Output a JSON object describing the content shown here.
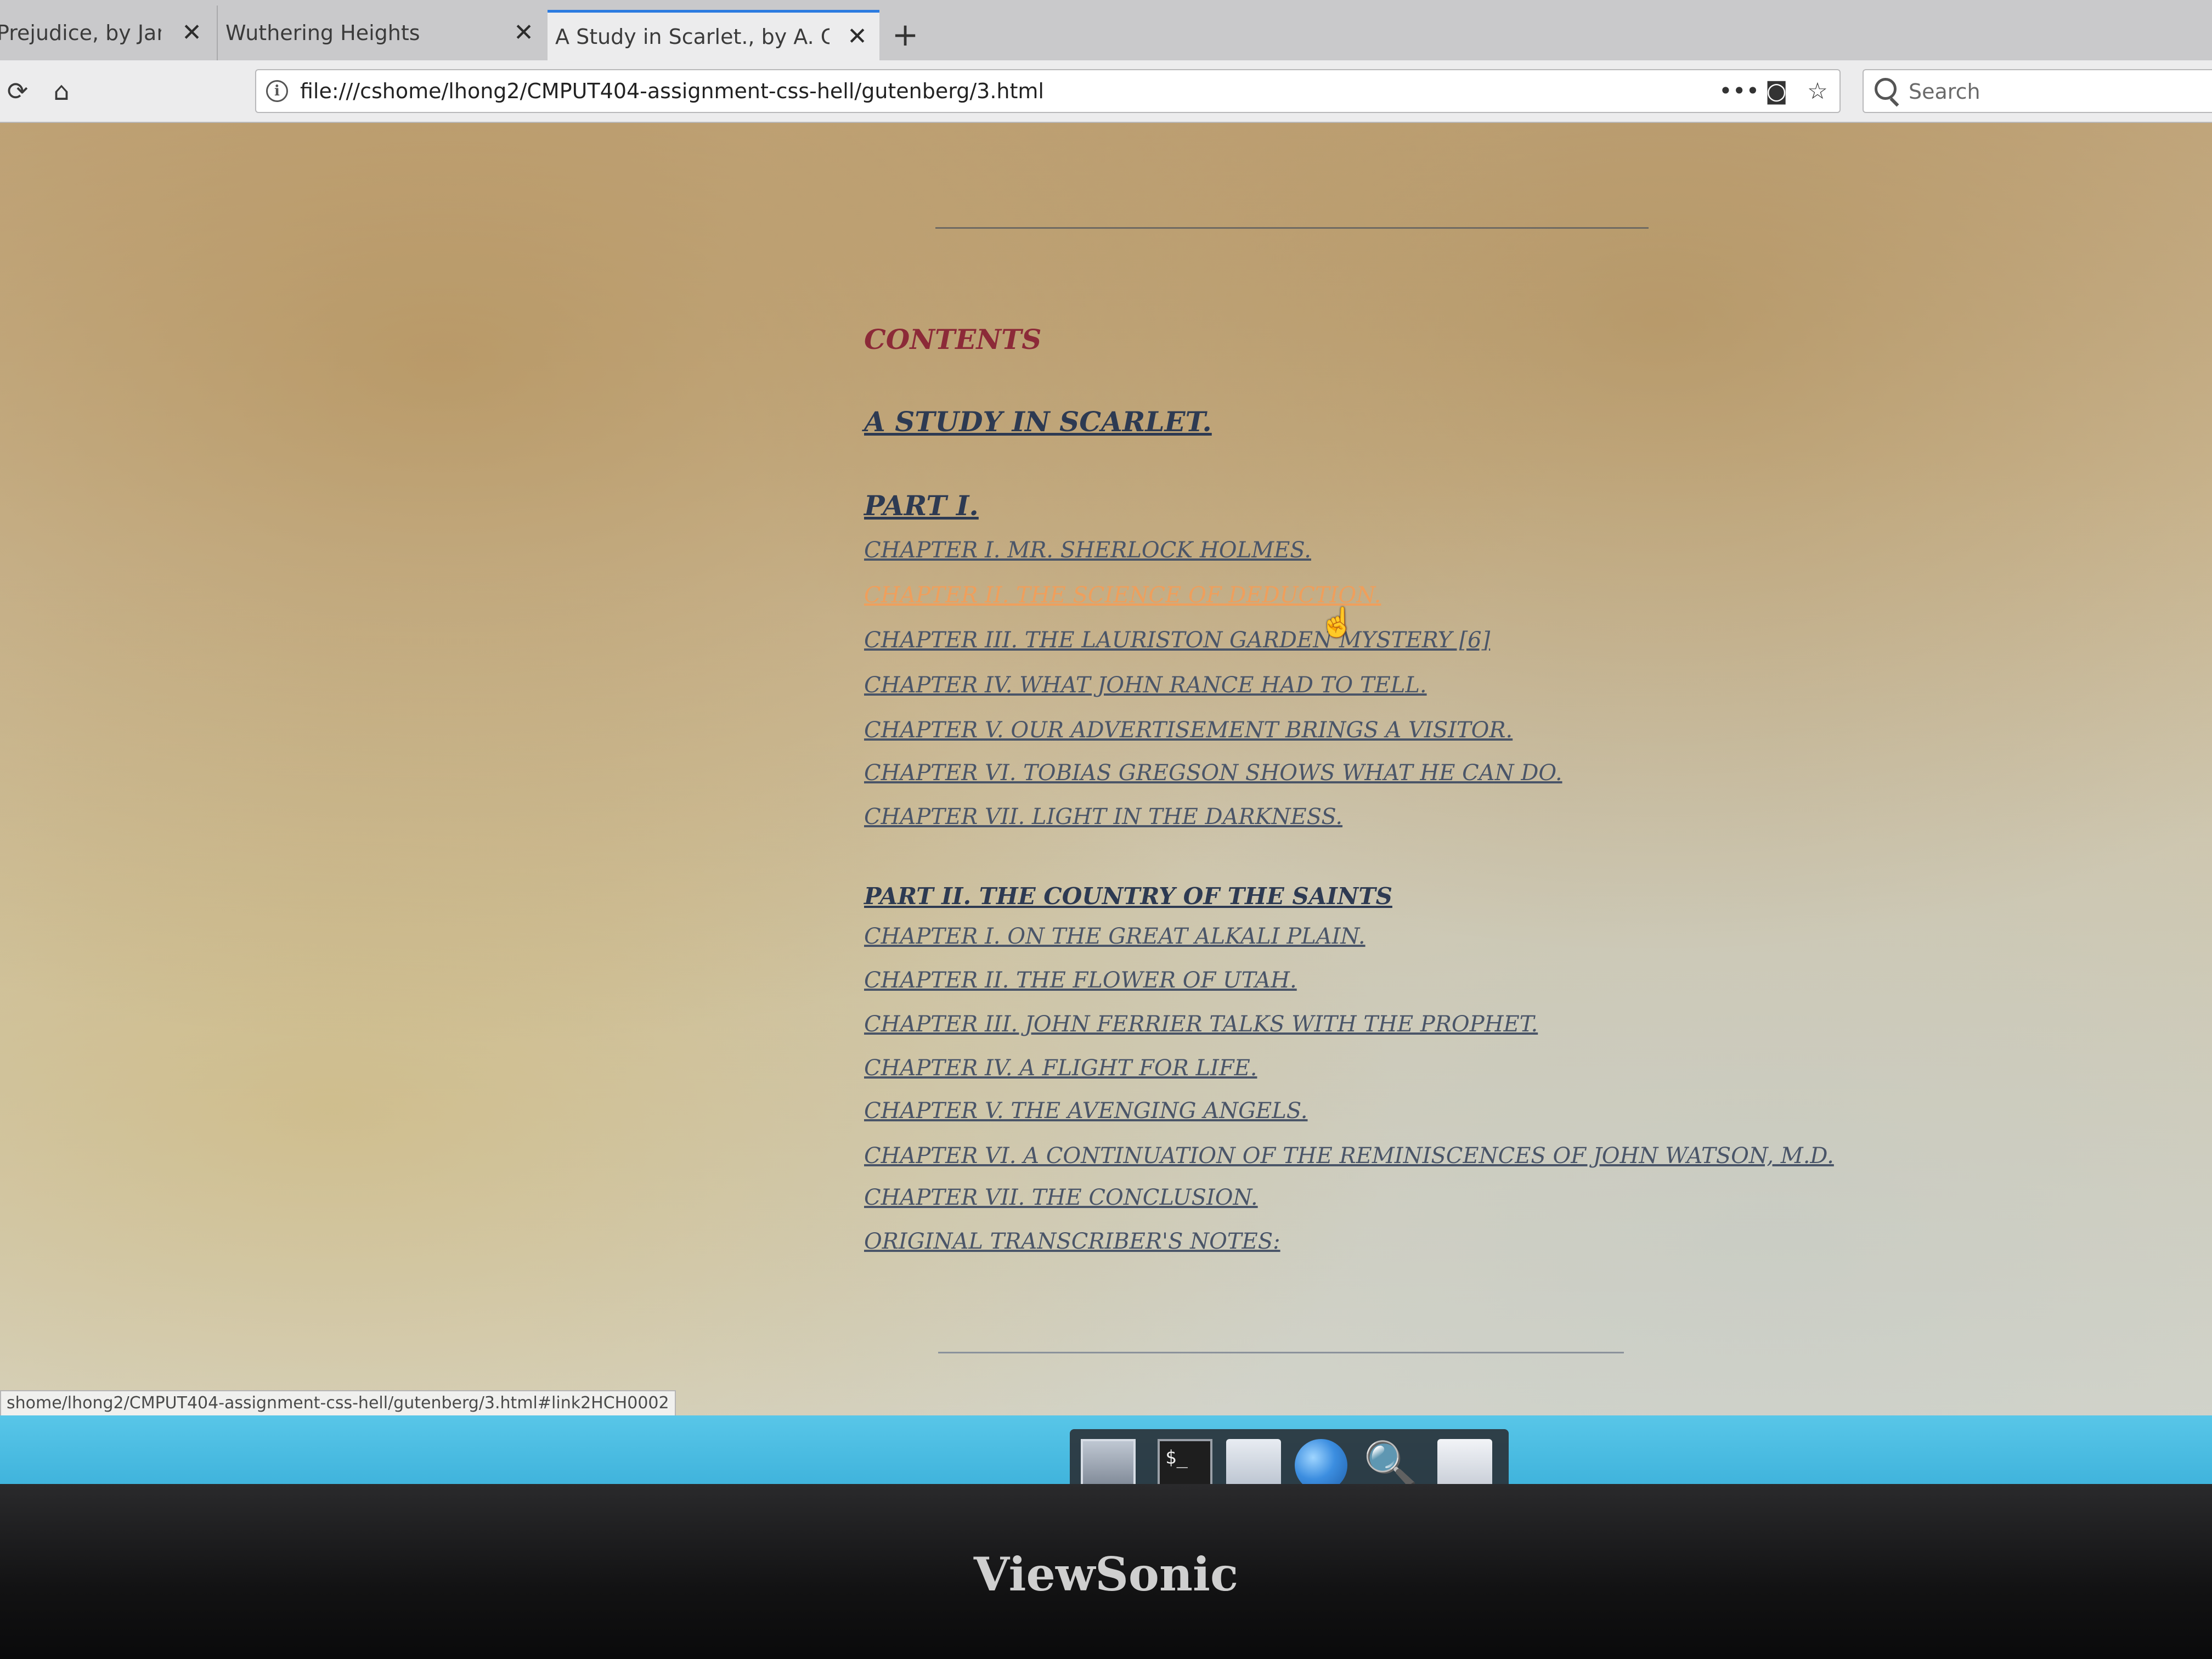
{
  "browser": {
    "tabs": [
      {
        "label": "Prejudice, by Jane A",
        "close": "✕"
      },
      {
        "label": "Wuthering Heights",
        "close": "✕"
      },
      {
        "label": "A Study in Scarlet., by A. Con",
        "close": "✕"
      }
    ],
    "new_tab": "+",
    "url": "file:///cshome/lhong2/CMPUT404-assignment-css-hell/gutenberg/3.html",
    "search_placeholder": "Search",
    "page_actions": "•••"
  },
  "page": {
    "contents_heading": "CONTENTS",
    "book_title": "A STUDY IN SCARLET.",
    "part1": {
      "title": "PART I.",
      "chapters": [
        "CHAPTER I. MR. SHERLOCK HOLMES.",
        "CHAPTER II. THE SCIENCE OF DEDUCTION.",
        "CHAPTER III. THE LAURISTON GARDEN MYSTERY [6]",
        "CHAPTER IV. WHAT JOHN RANCE HAD TO TELL.",
        "CHAPTER V. OUR ADVERTISEMENT BRINGS A VISITOR.",
        "CHAPTER VI. TOBIAS GREGSON SHOWS WHAT HE CAN DO.",
        "CHAPTER VII. LIGHT IN THE DARKNESS."
      ]
    },
    "part2": {
      "title": "PART II. THE COUNTRY OF THE SAINTS",
      "chapters": [
        "CHAPTER I. ON THE GREAT ALKALI PLAIN.",
        "CHAPTER II. THE FLOWER OF UTAH.",
        "CHAPTER III. JOHN FERRIER TALKS WITH THE PROPHET.",
        "CHAPTER IV. A FLIGHT FOR LIFE.",
        "CHAPTER V. THE AVENGING ANGELS.",
        "CHAPTER VI. A CONTINUATION OF THE REMINISCENCES OF JOHN WATSON, M.D.",
        "CHAPTER VII. THE CONCLUSION.",
        "ORIGINAL TRANSCRIBER'S NOTES:"
      ]
    },
    "status_url": "shome/lhong2/CMPUT404-assignment-css-hell/gutenberg/3.html#link2HCH0002",
    "hovered_chapter_index": 1
  },
  "dock": {
    "terminal_glyph": "$_",
    "magnifier_glyph": "🔍"
  },
  "monitor": {
    "brand": "ViewSonic"
  },
  "colors": {
    "contents_heading": "#8c2a38",
    "link": "#4a5568",
    "link_hover": "#ef9f5c",
    "taskbar": "#3fb3dc"
  }
}
